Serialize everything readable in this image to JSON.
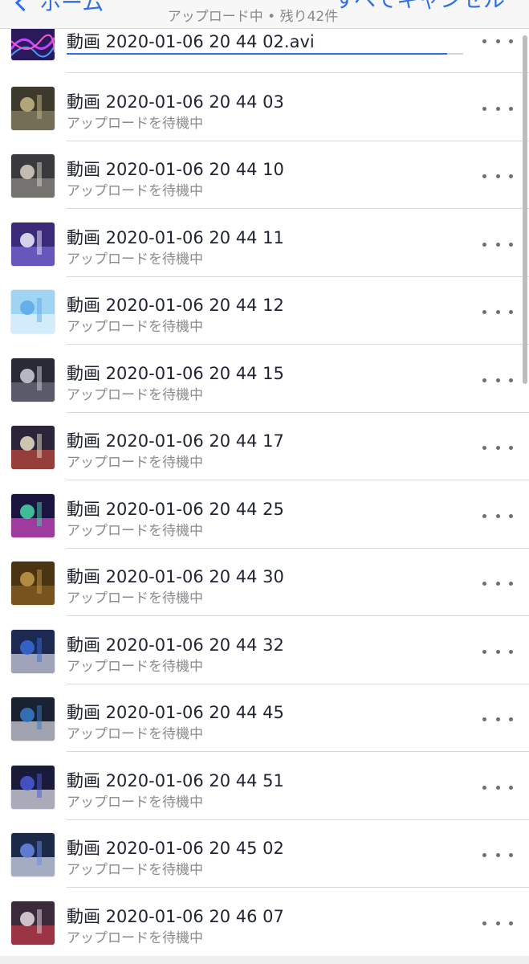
{
  "nav": {
    "back_label": "ホーム",
    "subtitle": "アップロード中 • 残り42件",
    "cancel_all_label": "すべてキャンセル"
  },
  "current_upload": {
    "title": "動画 2020-01-06 20 44 02.avi",
    "progress_fraction": 0.96
  },
  "waiting_status": "アップロードを待機中",
  "items": [
    {
      "title": "動画 2020-01-06 20 44 03",
      "status": "アップロードを待機中"
    },
    {
      "title": "動画 2020-01-06 20 44 10",
      "status": "アップロードを待機中"
    },
    {
      "title": "動画 2020-01-06 20 44 11",
      "status": "アップロードを待機中"
    },
    {
      "title": "動画 2020-01-06 20 44 12",
      "status": "アップロードを待機中"
    },
    {
      "title": "動画 2020-01-06 20 44 15",
      "status": "アップロードを待機中"
    },
    {
      "title": "動画 2020-01-06 20 44 17",
      "status": "アップロードを待機中"
    },
    {
      "title": "動画 2020-01-06 20 44 25",
      "status": "アップロードを待機中"
    },
    {
      "title": "動画 2020-01-06 20 44 30",
      "status": "アップロードを待機中"
    },
    {
      "title": "動画 2020-01-06 20 44 32",
      "status": "アップロードを待機中"
    },
    {
      "title": "動画 2020-01-06 20 44 45",
      "status": "アップロードを待機中"
    },
    {
      "title": "動画 2020-01-06 20 44 51",
      "status": "アップロードを待機中"
    },
    {
      "title": "動画 2020-01-06 20 45 02",
      "status": "アップロードを待機中"
    },
    {
      "title": "動画 2020-01-06 20 46 07",
      "status": "アップロードを待機中"
    }
  ],
  "icons": {
    "back": "chevron-left-icon",
    "more": "more-horizontal-icon",
    "thumbnail": "video-thumbnail"
  },
  "colors": {
    "accent": "#2f6fe4",
    "text_primary": "#1f2430",
    "text_secondary": "#8a8a8e"
  }
}
